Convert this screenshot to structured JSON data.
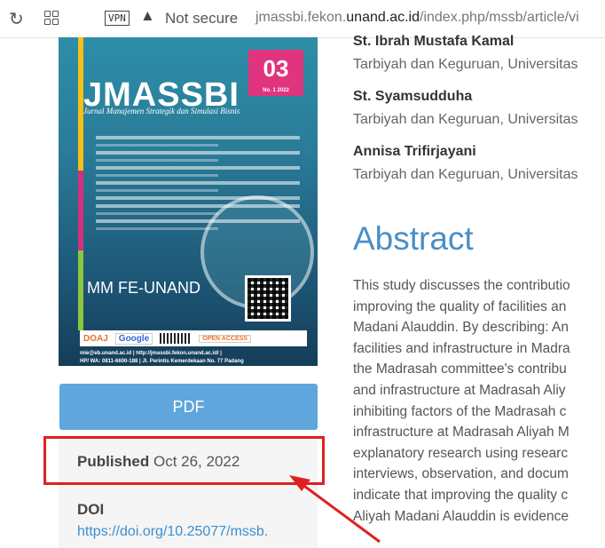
{
  "browser": {
    "reload_icon": "reload-icon",
    "apps_icon": "apps-grid-icon",
    "vpn_label": "VPN",
    "warning_icon": "warning-triangle-icon",
    "security_label": "Not secure",
    "url_prefix": "jmassbi.fekon.",
    "url_domain": "unand.ac.id",
    "url_path": "/index.php/mssb/article/vi"
  },
  "cover": {
    "title": "JMASSBI",
    "subtitle": "Jurnal Manajemen Strategik dan Simulasi Bisnis",
    "issue_number": "03",
    "issue_label": "No. 1 2022",
    "brand": "MM FE-UNAND",
    "logos": [
      "DOAJ",
      "Google",
      "OPEN ACCESS"
    ],
    "footer_line1": "mie@eb.unand.ac.id | http://jmassbi.fekon.unand.ac.id/ |",
    "footer_line2": "HP/ WA: 0811-6600-188 | Jl. Perintis Kemerdekaan No. 77 Padang"
  },
  "pdf_button": {
    "label": "PDF"
  },
  "published": {
    "label": "Published",
    "date": "Oct 26, 2022"
  },
  "doi": {
    "label": "DOI",
    "link": "https://doi.org/10.25077/mssb."
  },
  "authors": [
    {
      "name": "St. Ibrah Mustafa Kamal",
      "affiliation": "Tarbiyah dan Keguruan, Universitas"
    },
    {
      "name": "St. Syamsudduha",
      "affiliation": "Tarbiyah dan Keguruan, Universitas"
    },
    {
      "name": "Annisa Trifirjayani",
      "affiliation": "Tarbiyah dan Keguruan, Universitas"
    }
  ],
  "abstract": {
    "heading": "Abstract",
    "lines": [
      "This study discusses the contributio",
      "improving the quality of facilities an",
      "Madani Alauddin. By describing: An",
      "facilities and infrastructure in Madra",
      "the Madrasah committee's contribu",
      "and infrastructure at Madrasah Aliy",
      "inhibiting factors of the Madrasah c",
      "infrastructure at Madrasah Aliyah M",
      "explanatory research using researc",
      "interviews, observation, and docum",
      "indicate that improving the quality c",
      "Aliyah Madani Alauddin is evidence"
    ]
  },
  "colors": {
    "accent": "#4a8ec6",
    "button": "#5fa6dc",
    "highlight": "#e02020"
  }
}
